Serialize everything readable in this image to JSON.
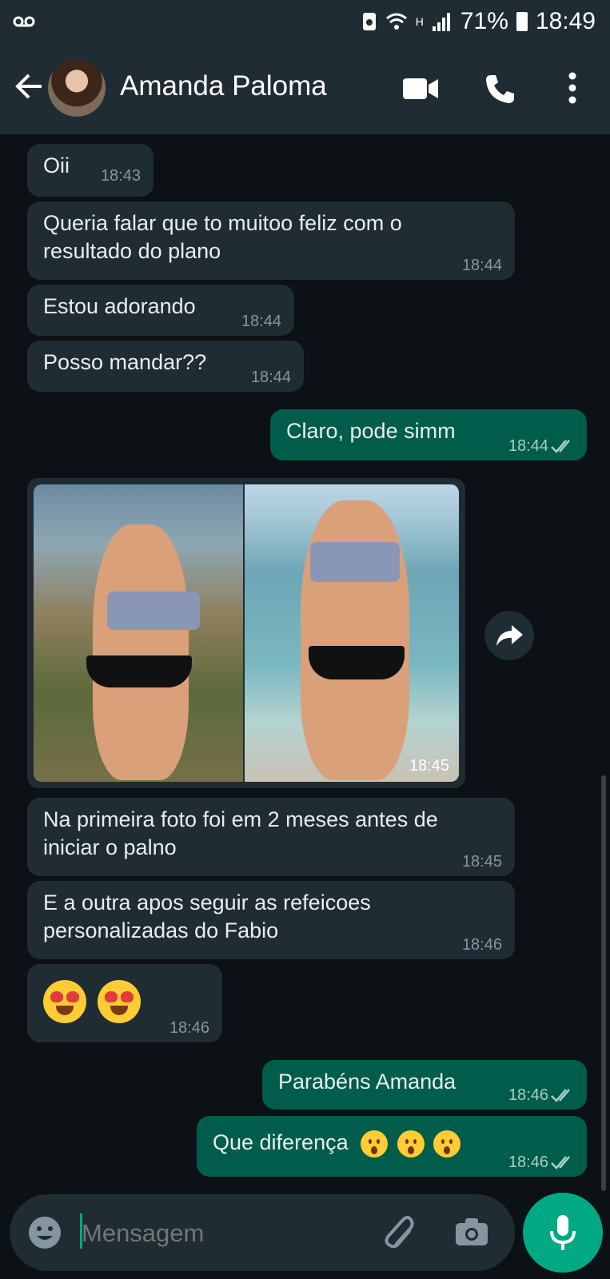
{
  "status_bar": {
    "left_icon": "voicemail-icon",
    "network_label": "H",
    "battery": "71%",
    "time": "18:49"
  },
  "header": {
    "contact_name": "Amanda Paloma",
    "icons": [
      "back-arrow-icon",
      "video-call-icon",
      "phone-icon",
      "more-options-icon"
    ]
  },
  "messages": [
    {
      "dir": "in",
      "text": "Oii",
      "time": "18:43"
    },
    {
      "dir": "in",
      "text": "Queria falar que to muitoo feliz com o resultado do plano",
      "time": "18:44"
    },
    {
      "dir": "in",
      "text": "Estou adorando",
      "time": "18:44"
    },
    {
      "dir": "in",
      "text": "Posso mandar??",
      "time": "18:44"
    },
    {
      "dir": "out",
      "text": "Claro, pode simm",
      "time": "18:44"
    },
    {
      "dir": "in",
      "type": "image",
      "time": "18:45"
    },
    {
      "dir": "in",
      "text": "Na primeira foto foi em 2 meses antes de iniciar o palno",
      "time": "18:45"
    },
    {
      "dir": "in",
      "text": "E a outra apos seguir as refeicoes personalizadas do Fabio",
      "time": "18:46"
    },
    {
      "dir": "in",
      "type": "emoji",
      "emoji": "heart-eyes x2",
      "time": "18:46"
    },
    {
      "dir": "out",
      "text": "Parabéns Amanda",
      "time": "18:46"
    },
    {
      "dir": "out",
      "text": "Que diferença",
      "emoji": "hushed-face x3",
      "time": "18:46"
    }
  ],
  "composer": {
    "placeholder": "Mensagem",
    "icons": [
      "emoji-icon",
      "attach-icon",
      "camera-icon",
      "microphone-icon"
    ]
  },
  "colors": {
    "header_bg": "#1f2c34",
    "chat_bg": "#0b1114",
    "incoming_bubble": "#1f2c34",
    "outgoing_bubble": "#005c4b",
    "accent": "#00a884"
  }
}
